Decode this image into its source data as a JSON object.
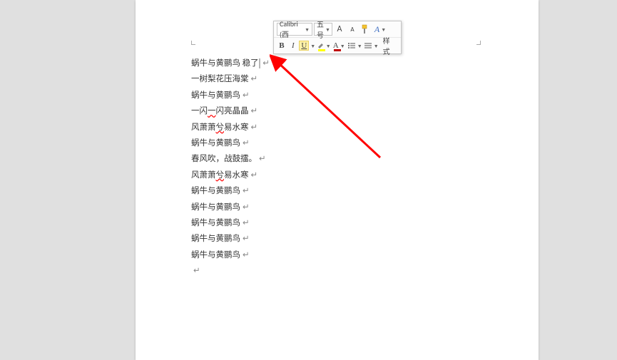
{
  "toolbar": {
    "font_name": "Calibri (西",
    "font_size": "五号",
    "grow_font": "A",
    "shrink_font": "A",
    "bold": "B",
    "italic": "I",
    "underline": "U",
    "font_color_letter": "A",
    "styles_label": "样式"
  },
  "document": {
    "lines": [
      {
        "text_pre": "蜗牛与黄鹂鸟 稳了",
        "selected_tail": "    ",
        "mark": "↵"
      },
      {
        "text": "一树梨花压海棠",
        "mark": "↵"
      },
      {
        "text": "蜗牛与黄鹂鸟",
        "mark": "↵"
      },
      {
        "text_pre": "一闪",
        "err": "一",
        "text_post": "闪亮晶晶",
        "mark": "↵"
      },
      {
        "text_pre": "风萧萧",
        "err": "兮",
        "text_post": "易水寒",
        "mark": "↵"
      },
      {
        "text": "蜗牛与黄鹂鸟",
        "mark": "↵"
      },
      {
        "text": "春风吹，战鼓擂。",
        "mark": "↵"
      },
      {
        "text_pre": "风萧萧",
        "err": "兮",
        "text_post": "易水寒",
        "mark": "↵"
      },
      {
        "text": "蜗牛与黄鹂鸟",
        "mark": "↵"
      },
      {
        "text": "蜗牛与黄鹂鸟",
        "mark": "↵"
      },
      {
        "text": "蜗牛与黄鹂鸟",
        "mark": "↵"
      },
      {
        "text": "蜗牛与黄鹂鸟",
        "mark": "↵"
      },
      {
        "text": "蜗牛与黄鹂鸟",
        "mark": "↵"
      },
      {
        "text": "",
        "mark": "↵"
      }
    ]
  }
}
